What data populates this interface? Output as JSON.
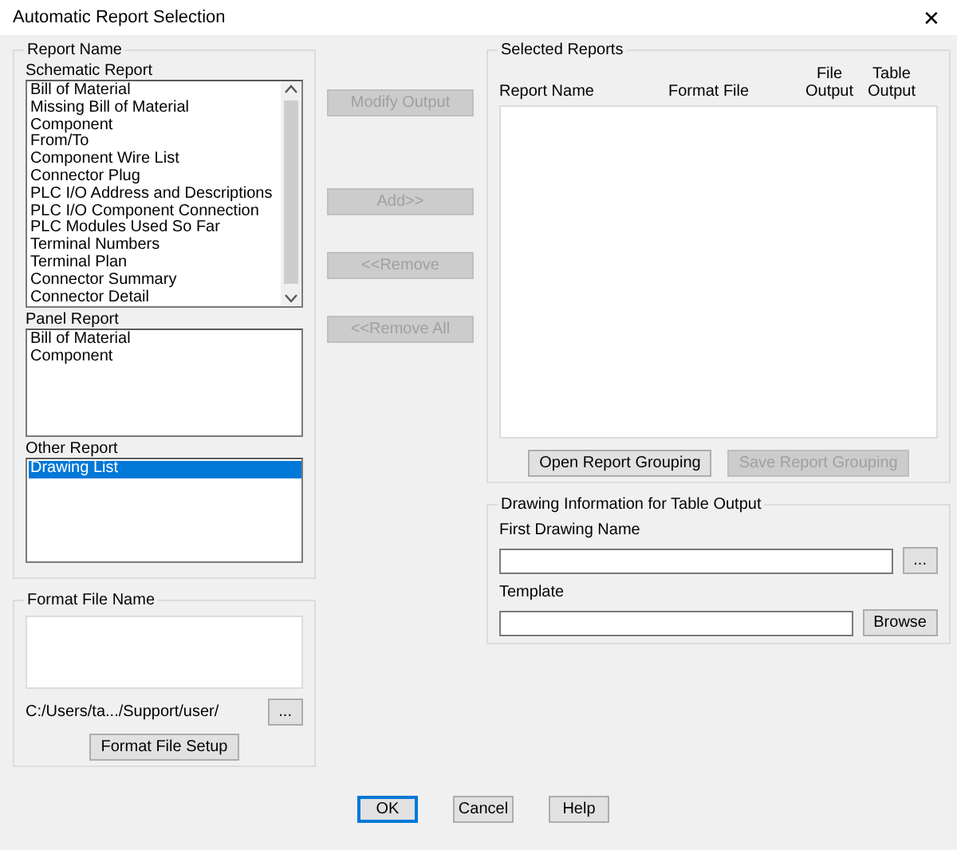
{
  "window": {
    "title": "Automatic Report Selection",
    "close": "✕"
  },
  "report_name": {
    "title": "Report Name",
    "lists": [
      {
        "label": "Schematic Report",
        "scrollable": true,
        "items": [
          {
            "text": "Bill of Material",
            "selected": false
          },
          {
            "text": "Missing Bill of Material",
            "selected": false
          },
          {
            "text": "Component",
            "selected": false
          },
          {
            "text": "From/To",
            "selected": false
          },
          {
            "text": "Component Wire List",
            "selected": false
          },
          {
            "text": "Connector Plug",
            "selected": false
          },
          {
            "text": "PLC I/O Address and Descriptions",
            "selected": false
          },
          {
            "text": "PLC I/O Component Connection",
            "selected": false
          },
          {
            "text": "PLC Modules Used So Far",
            "selected": false
          },
          {
            "text": "Terminal Numbers",
            "selected": false
          },
          {
            "text": "Terminal Plan",
            "selected": false
          },
          {
            "text": "Connector Summary",
            "selected": false
          },
          {
            "text": "Connector Detail",
            "selected": false
          }
        ]
      },
      {
        "label": "Panel Report",
        "scrollable": false,
        "items": [
          {
            "text": "Bill of Material",
            "selected": false
          },
          {
            "text": "Component",
            "selected": false
          }
        ]
      },
      {
        "label": "Other Report",
        "scrollable": false,
        "items": [
          {
            "text": "Drawing List",
            "selected": true
          }
        ]
      }
    ]
  },
  "middle_buttons": [
    {
      "label": "Modify Output",
      "disabled": true
    },
    {
      "label": "Add>>",
      "disabled": true
    },
    {
      "label": "<<Remove",
      "disabled": true
    },
    {
      "label": "<<Remove All",
      "disabled": true
    }
  ],
  "format_file": {
    "title": "Format File Name",
    "path": "C:/Users/ta.../Support/user/",
    "browse": {
      "label": "...",
      "disabled": false
    },
    "setup_button": {
      "label": "Format File Setup",
      "disabled": false
    }
  },
  "selected_reports": {
    "title": "Selected Reports",
    "columns": [
      "Report Name",
      "Format File",
      "File Output",
      "Table Output"
    ],
    "buttons": [
      {
        "label": "Open Report Grouping",
        "disabled": false
      },
      {
        "label": "Save Report Grouping",
        "disabled": true
      }
    ]
  },
  "drawing_info": {
    "title": "Drawing Information for Table Output",
    "fields": [
      {
        "label": "First Drawing Name",
        "button": {
          "label": "...",
          "disabled": false
        }
      },
      {
        "label": "Template",
        "button": {
          "label": "Browse",
          "disabled": false
        }
      }
    ]
  },
  "footer_buttons": [
    {
      "label": "OK",
      "default": true
    },
    {
      "label": "Cancel",
      "default": false
    },
    {
      "label": "Help",
      "default": false
    }
  ]
}
